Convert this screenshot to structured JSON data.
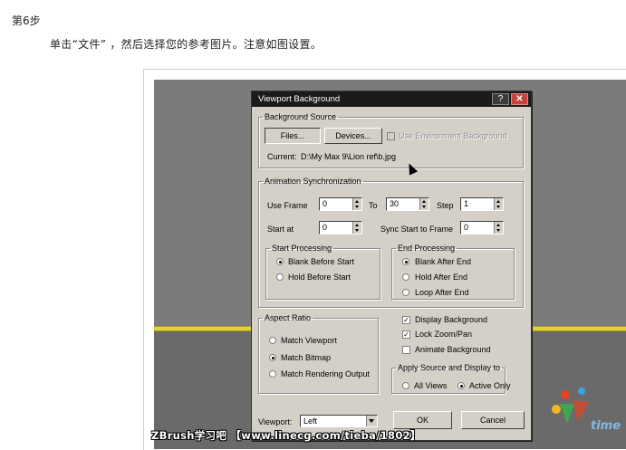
{
  "page": {
    "step_title": "第6步",
    "instruction": "单击“文件” ，然后选择您的参考图片。注意如图设置。"
  },
  "dialog": {
    "title": "Viewport Background",
    "help_button": "?",
    "close_button": "✕",
    "background_source": {
      "legend": "Background Source",
      "files_button": "Files...",
      "devices_button": "Devices...",
      "use_env_bg_label": "Use Environment Background",
      "use_env_bg_checked": false,
      "current_label": "Current:",
      "current_path": "D:\\My Max 9\\Lion ref\\b.jpg"
    },
    "animation_sync": {
      "legend": "Animation Synchronization",
      "use_frame_label": "Use Frame",
      "use_frame_value": "0",
      "to_label": "To",
      "to_value": "30",
      "step_label": "Step",
      "step_value": "1",
      "start_at_label": "Start at",
      "start_at_value": "0",
      "sync_start_label": "Sync Start to Frame",
      "sync_start_value": "0"
    },
    "start_processing": {
      "legend": "Start Processing",
      "options": [
        "Blank Before Start",
        "Hold Before Start"
      ],
      "selected": "Blank Before Start"
    },
    "end_processing": {
      "legend": "End Processing",
      "options": [
        "Blank After End",
        "Hold After End",
        "Loop After End"
      ],
      "selected": "Blank After End"
    },
    "aspect_ratio": {
      "legend": "Aspect Ratio",
      "options": [
        "Match Viewport",
        "Match Bitmap",
        "Match Rendering Output"
      ],
      "selected": "Match Bitmap"
    },
    "checkboxes": {
      "display_background": "Display Background",
      "display_background_checked": true,
      "lock_zoom_pan": "Lock Zoom/Pan",
      "lock_zoom_pan_checked": true,
      "animate_background": "Animate Background",
      "animate_background_checked": false
    },
    "apply_source": {
      "legend": "Apply Source and Display to",
      "options": [
        "All Views",
        "Active Only"
      ],
      "selected": "Active Only"
    },
    "viewport_label": "Viewport:",
    "viewport_value": "Left",
    "ok_button": "OK",
    "cancel_button": "Cancel"
  },
  "watermark": "ZBrush学习吧 【www.linecg.com/tieba/1802】",
  "logo_text": "time",
  "colors": {
    "title_bar": "#1b1b1b",
    "close_button": "#c8413a",
    "dialog_face": "#d4d0c8",
    "viewport_gray": "#7b7b7b",
    "grid_line": "#e2d23a"
  }
}
